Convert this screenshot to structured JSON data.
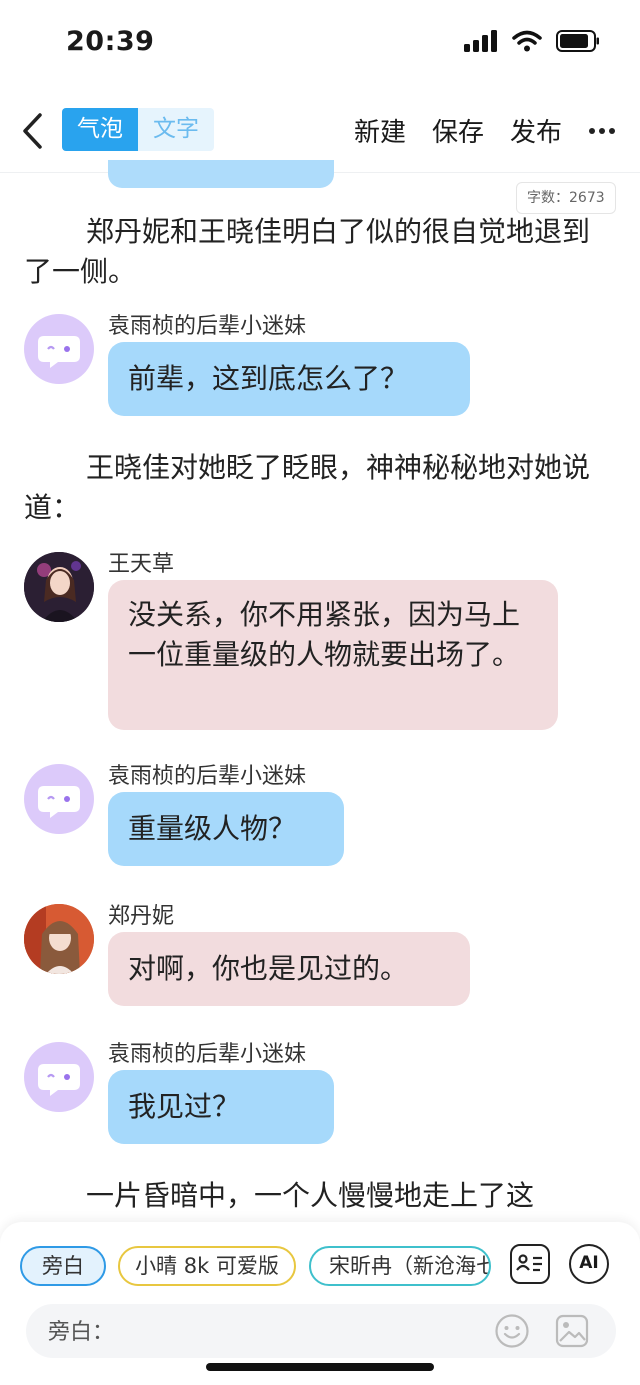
{
  "status_bar": {
    "time": "20:39"
  },
  "nav": {
    "segments": [
      "气泡",
      "文字"
    ],
    "actions": {
      "new": "新建",
      "save": "保存",
      "publish": "发布"
    }
  },
  "word_count": "字数：2673",
  "story": [
    {
      "type": "narration",
      "text": "郑丹妮和王晓佳明白了似的很自觉地退到了一侧。"
    },
    {
      "type": "message",
      "sender": "袁雨桢的后辈小迷妹",
      "text": "前辈，这到底怎么了？",
      "style": "blue"
    },
    {
      "type": "narration",
      "text": "王晓佳对她眨了眨眼，神神秘秘地对她说道："
    },
    {
      "type": "message",
      "sender": "王天草",
      "text": "没关系，你不用紧张，因为马上一位重量级的人物就要出场了。",
      "style": "pink"
    },
    {
      "type": "message",
      "sender": "袁雨桢的后辈小迷妹",
      "text": "重量级人物？",
      "style": "blue"
    },
    {
      "type": "message",
      "sender": "郑丹妮",
      "text": "对啊，你也是见过的。",
      "style": "pink"
    },
    {
      "type": "message",
      "sender": "袁雨桢的后辈小迷妹",
      "text": "我见过？",
      "style": "blue"
    },
    {
      "type": "narration",
      "text": "一片昏暗中，一个人慢慢地走上了这"
    }
  ],
  "composer": {
    "chips": [
      "旁白",
      "小晴 8k 可爱版",
      "宋昕冉（新沧海七"
    ],
    "ai_label": "AI",
    "input_label": "旁白："
  },
  "colors": {
    "accent": "#29a3ee",
    "bubble_blue": "#a6d9fb",
    "bubble_pink": "#f2dcde"
  }
}
